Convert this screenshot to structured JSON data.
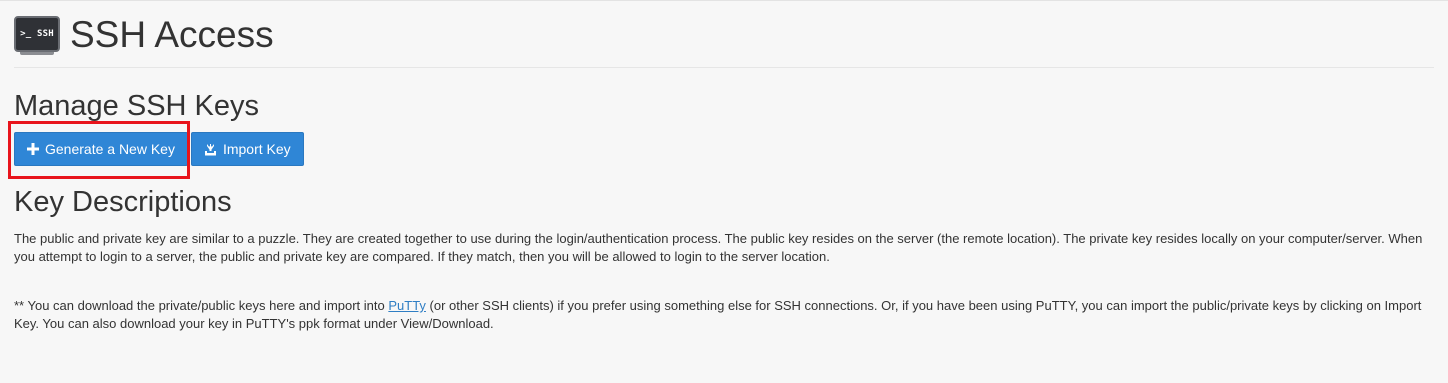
{
  "header": {
    "icon_text": ">_ SSH",
    "icon_name": "ssh-terminal-icon",
    "title": "SSH Access"
  },
  "manage": {
    "heading": "Manage SSH Keys",
    "generate_button": {
      "icon": "plus-icon",
      "label": "Generate a New Key"
    },
    "import_button": {
      "icon": "import-icon",
      "label": "Import Key"
    }
  },
  "descriptions": {
    "heading": "Key Descriptions",
    "paragraph": "The public and private key are similar to a puzzle. They are created together to use during the login/authentication process. The public key resides on the server (the remote location). The private key resides locally on your computer/server. When you attempt to login to a server, the public and private key are compared. If they match, then you will be allowed to login to the server location.",
    "note_before_link": "** You can download the private/public keys here and import into ",
    "note_link": "PuTTy",
    "note_after_link": " (or other SSH clients) if you prefer using something else for SSH connections. Or, if you have been using PuTTY, you can import the public/private keys by clicking on Import Key. You can also download your key in PuTTY's ppk format under View/Download."
  },
  "colors": {
    "button_primary": "#2f86d6",
    "highlight": "#e8141c",
    "link": "#2f7ec4"
  }
}
